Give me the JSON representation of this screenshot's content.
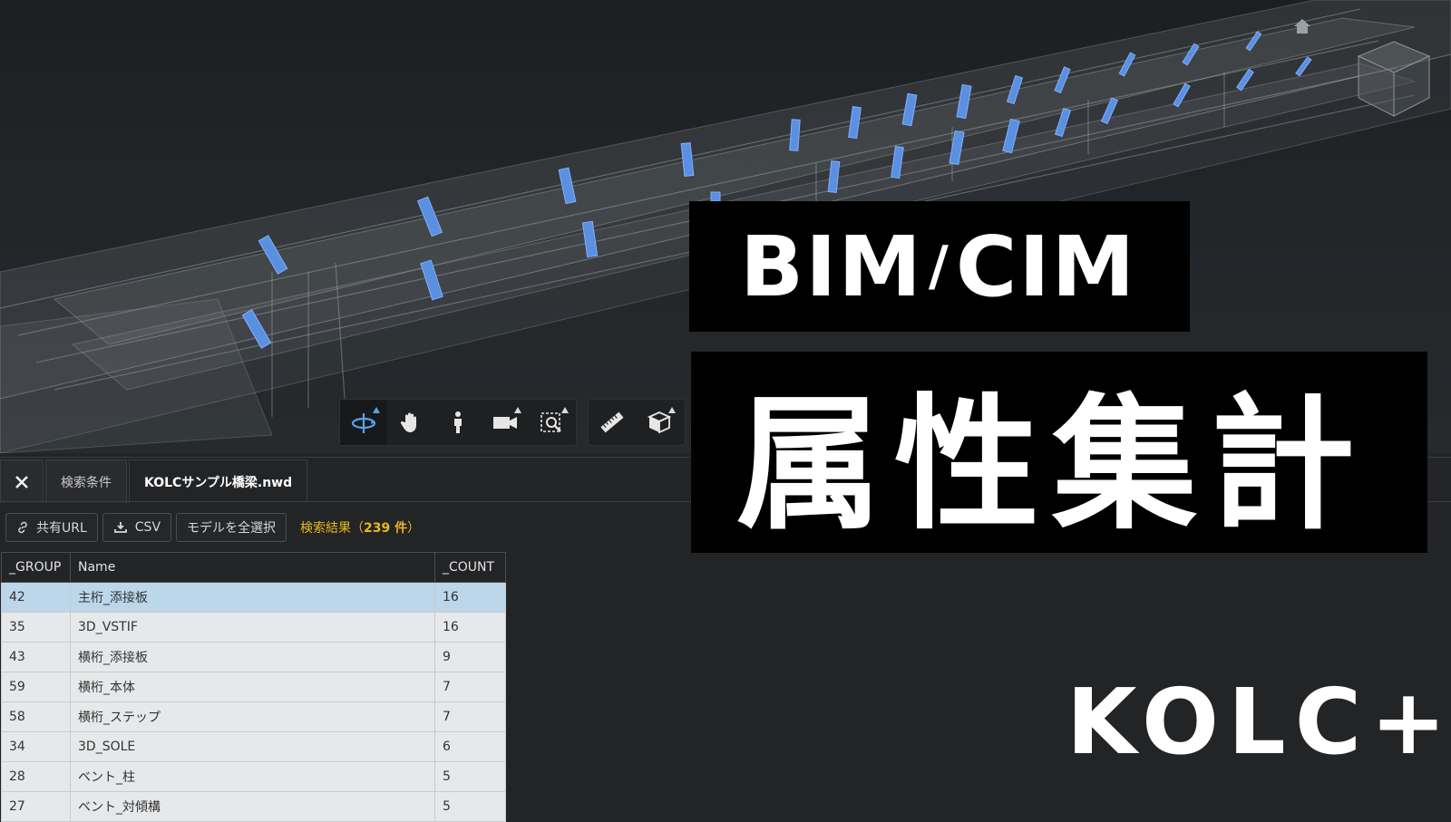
{
  "toolbar": {
    "tools": [
      {
        "name": "orbit",
        "icon": "orbit-icon",
        "active": true,
        "has_menu": true
      },
      {
        "name": "pan",
        "icon": "hand-icon",
        "active": false,
        "has_menu": false
      },
      {
        "name": "walk",
        "icon": "person-icon",
        "active": false,
        "has_menu": false
      },
      {
        "name": "camera",
        "icon": "camera-icon",
        "active": false,
        "has_menu": true
      },
      {
        "name": "zoom-window",
        "icon": "zoom-window-icon",
        "active": false,
        "has_menu": true
      },
      {
        "name": "measure",
        "icon": "ruler-icon",
        "active": false,
        "has_menu": false
      },
      {
        "name": "section",
        "icon": "section-box-icon",
        "active": false,
        "has_menu": true
      }
    ]
  },
  "tabs": {
    "close_icon": "close-icon",
    "search_conditions": "検索条件",
    "file": "KOLCサンプル橋梁.nwd"
  },
  "actions": {
    "share_url": "共有URL",
    "csv": "CSV",
    "select_all": "モデルを全選択",
    "result_prefix": "検索結果（",
    "result_count": "239 件",
    "result_suffix": "）"
  },
  "table": {
    "headers": [
      "_GROUP",
      "Name",
      "_COUNT"
    ],
    "rows": [
      {
        "group": "42",
        "name": "主桁_添接板",
        "count": "16",
        "selected": true
      },
      {
        "group": "35",
        "name": "3D_VSTIF",
        "count": "16"
      },
      {
        "group": "43",
        "name": "横桁_添接板",
        "count": "9"
      },
      {
        "group": "59",
        "name": "横桁_本体",
        "count": "7"
      },
      {
        "group": "58",
        "name": "横桁_ステップ",
        "count": "7"
      },
      {
        "group": "34",
        "name": "3D_SOLE",
        "count": "6"
      },
      {
        "group": "28",
        "name": "ベント_柱",
        "count": "5"
      },
      {
        "group": "27",
        "name": "ベント_対傾構",
        "count": "5"
      }
    ]
  },
  "overlay": {
    "title_left": "BIM",
    "title_slash": "/",
    "title_right": "CIM",
    "subtitle": "属性集計",
    "brand": "KOLC+"
  },
  "colors": {
    "highlight_blue": "#5b8fe0",
    "accent_yellow": "#e8b720",
    "selected_row": "#bcd6ea"
  }
}
